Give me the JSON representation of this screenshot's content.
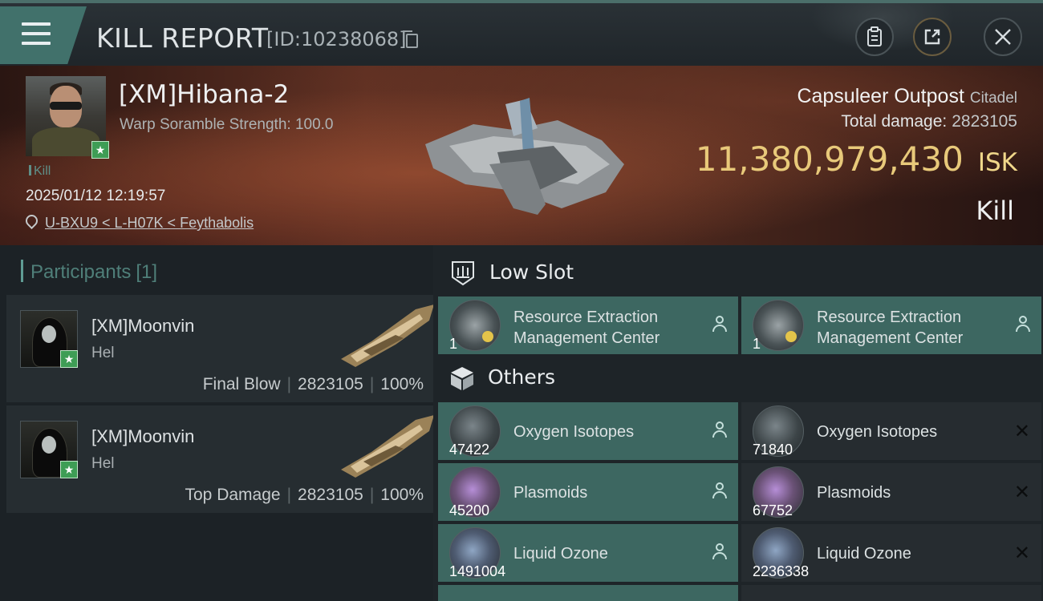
{
  "header": {
    "title": "KILL REPORT",
    "report_id": "[ID:10238068]",
    "buttons": [
      "clipboard-icon",
      "share-icon",
      "close-icon"
    ]
  },
  "victim": {
    "pilot_name": "[XM]Hibana-2",
    "scramble": "Warp Soramble Strength: 100.0",
    "kill_tag": "Kill",
    "datetime": "2025/01/12 12:19:57",
    "location": "U-BXU9 < L-H07K < Feythabolis",
    "target_name": "Capsuleer Outpost",
    "target_type": "Citadel",
    "total_damage_label": "Total damage:",
    "total_damage_value": "2823105",
    "isk_value": "11,380,979,430",
    "isk_unit": "ISK",
    "result": "Kill"
  },
  "participants": {
    "title": "Participants",
    "count": "[1]",
    "cards": [
      {
        "name": "[XM]Moonvin",
        "ship": "Hel",
        "role": "Final Blow",
        "damage": "2823105",
        "percent": "100%"
      },
      {
        "name": "[XM]Moonvin",
        "ship": "Hel",
        "role": "Top Damage",
        "damage": "2823105",
        "percent": "100%"
      }
    ]
  },
  "sections": {
    "low_slot": "Low Slot",
    "others": "Others"
  },
  "items": {
    "low_slot": [
      {
        "name_line1": "Resource Extraction",
        "name_line2": "Management Center",
        "qty": "1",
        "status": "dropped"
      },
      {
        "name_line1": "Resource Extraction",
        "name_line2": "Management Center",
        "qty": "1",
        "status": "dropped"
      }
    ],
    "others": [
      {
        "name": "Oxygen Isotopes",
        "qty": "47422",
        "status": "dropped"
      },
      {
        "name": "Oxygen Isotopes",
        "qty": "71840",
        "status": "destroyed"
      },
      {
        "name": "Plasmoids",
        "qty": "45200",
        "status": "dropped"
      },
      {
        "name": "Plasmoids",
        "qty": "67752",
        "status": "destroyed"
      },
      {
        "name": "Liquid Ozone",
        "qty": "1491004",
        "status": "dropped"
      },
      {
        "name": "Liquid Ozone",
        "qty": "2236338",
        "status": "destroyed"
      }
    ]
  },
  "colors": {
    "accent_teal": "#3d6761",
    "isk_gold": "#e8c97a",
    "badge_green": "#3e9d55"
  }
}
